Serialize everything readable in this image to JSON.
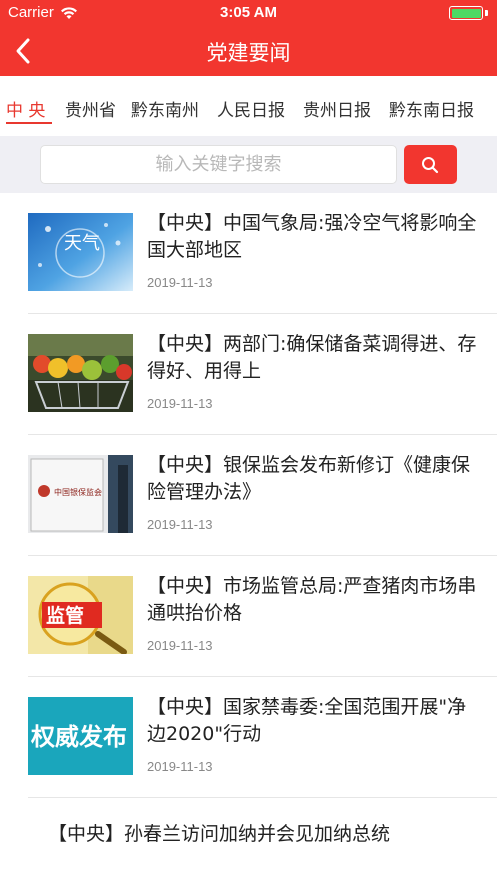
{
  "status_bar": {
    "carrier": "Carrier",
    "time": "3:05 AM",
    "icons": [
      "wifi-icon",
      "battery-icon"
    ]
  },
  "nav": {
    "title": "党建要闻",
    "back_icon": "chevron-left-icon",
    "color": "#f2362f"
  },
  "tabs": [
    {
      "label": "中 央",
      "active": true
    },
    {
      "label": "贵州省",
      "active": false
    },
    {
      "label": "黔东南州",
      "active": false
    },
    {
      "label": "人民日报",
      "active": false
    },
    {
      "label": "贵州日报",
      "active": false
    },
    {
      "label": "黔东南日报",
      "active": false
    }
  ],
  "search": {
    "placeholder": "输入关键字搜索",
    "button_icon": "search-icon"
  },
  "news": [
    {
      "title": "【中央】中国气象局:强冷空气将影响全国大部地区",
      "date": "2019-11-13",
      "thumb_text": "天气"
    },
    {
      "title": "【中央】两部门:确保储备菜调得进、存得好、用得上",
      "date": "2019-11-13",
      "thumb_text": ""
    },
    {
      "title": "【中央】银保监会发布新修订《健康保险管理办法》",
      "date": "2019-11-13",
      "thumb_text": "中国银保监会"
    },
    {
      "title": "【中央】市场监管总局:严查猪肉市场串通哄抬价格",
      "date": "2019-11-13",
      "thumb_text": "监管"
    },
    {
      "title": "【中央】国家禁毒委:全国范围开展\"净边2020\"行动",
      "date": "2019-11-13",
      "thumb_text": "权威发布"
    },
    {
      "title": "【中央】孙春兰访问加纳并会见加纳总统",
      "date": ""
    }
  ]
}
